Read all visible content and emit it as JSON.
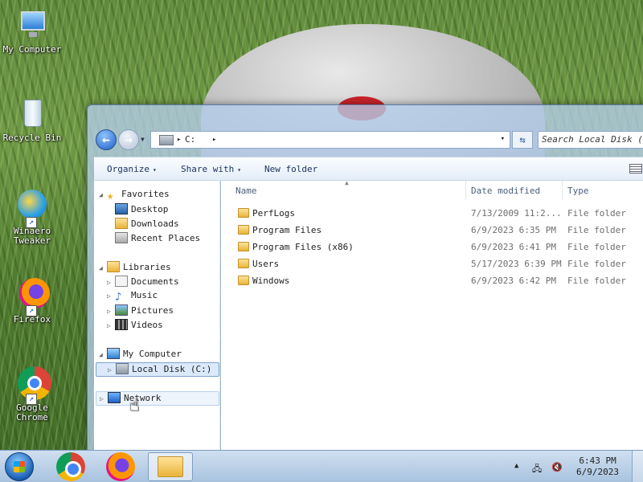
{
  "desktop": {
    "icons": [
      {
        "label": "My Computer",
        "icon": "computer-icon"
      },
      {
        "label": "Recycle Bin",
        "icon": "recycle-bin-icon"
      },
      {
        "label": "Winaero Tweaker",
        "icon": "winaero-tweaker-icon"
      },
      {
        "label": "Firefox",
        "icon": "firefox-icon"
      },
      {
        "label": "Google Chrome",
        "icon": "chrome-icon"
      }
    ]
  },
  "explorer": {
    "address": {
      "crumb": "C:",
      "crumb_arrow": "▸",
      "dropdown": "▾"
    },
    "search_placeholder": "Search Local Disk (C:)",
    "toolbar": {
      "organize": "Organize",
      "share_with": "Share with",
      "new_folder": "New folder",
      "caret": "▾"
    },
    "nav_pane": {
      "favorites": "Favorites",
      "desktop": "Desktop",
      "downloads": "Downloads",
      "recent_places": "Recent Places",
      "libraries": "Libraries",
      "documents": "Documents",
      "music": "Music",
      "pictures": "Pictures",
      "videos": "Videos",
      "my_computer": "My Computer",
      "local_disk": "Local Disk (C:)",
      "network": "Network"
    },
    "columns": {
      "name": "Name",
      "date_modified": "Date modified",
      "type": "Type"
    },
    "files": [
      {
        "name": "PerfLogs",
        "date": "7/13/2009 11:2...",
        "type": "File folder"
      },
      {
        "name": "Program Files",
        "date": "6/9/2023 6:35 PM",
        "type": "File folder"
      },
      {
        "name": "Program Files (x86)",
        "date": "6/9/2023 6:41 PM",
        "type": "File folder"
      },
      {
        "name": "Users",
        "date": "5/17/2023 6:39 PM",
        "type": "File folder"
      },
      {
        "name": "Windows",
        "date": "6/9/2023 6:42 PM",
        "type": "File folder"
      }
    ]
  },
  "taskbar": {
    "apps": [
      "chrome-icon",
      "firefox-icon",
      "explorer-icon"
    ],
    "tray": {
      "arrow": "▲"
    },
    "clock": {
      "time": "6:43 PM",
      "date": "6/9/2023"
    }
  },
  "colors": {
    "accent": "#1f5fc7",
    "selection": "#dbe9fb",
    "taskbar": "#a9c3df"
  }
}
